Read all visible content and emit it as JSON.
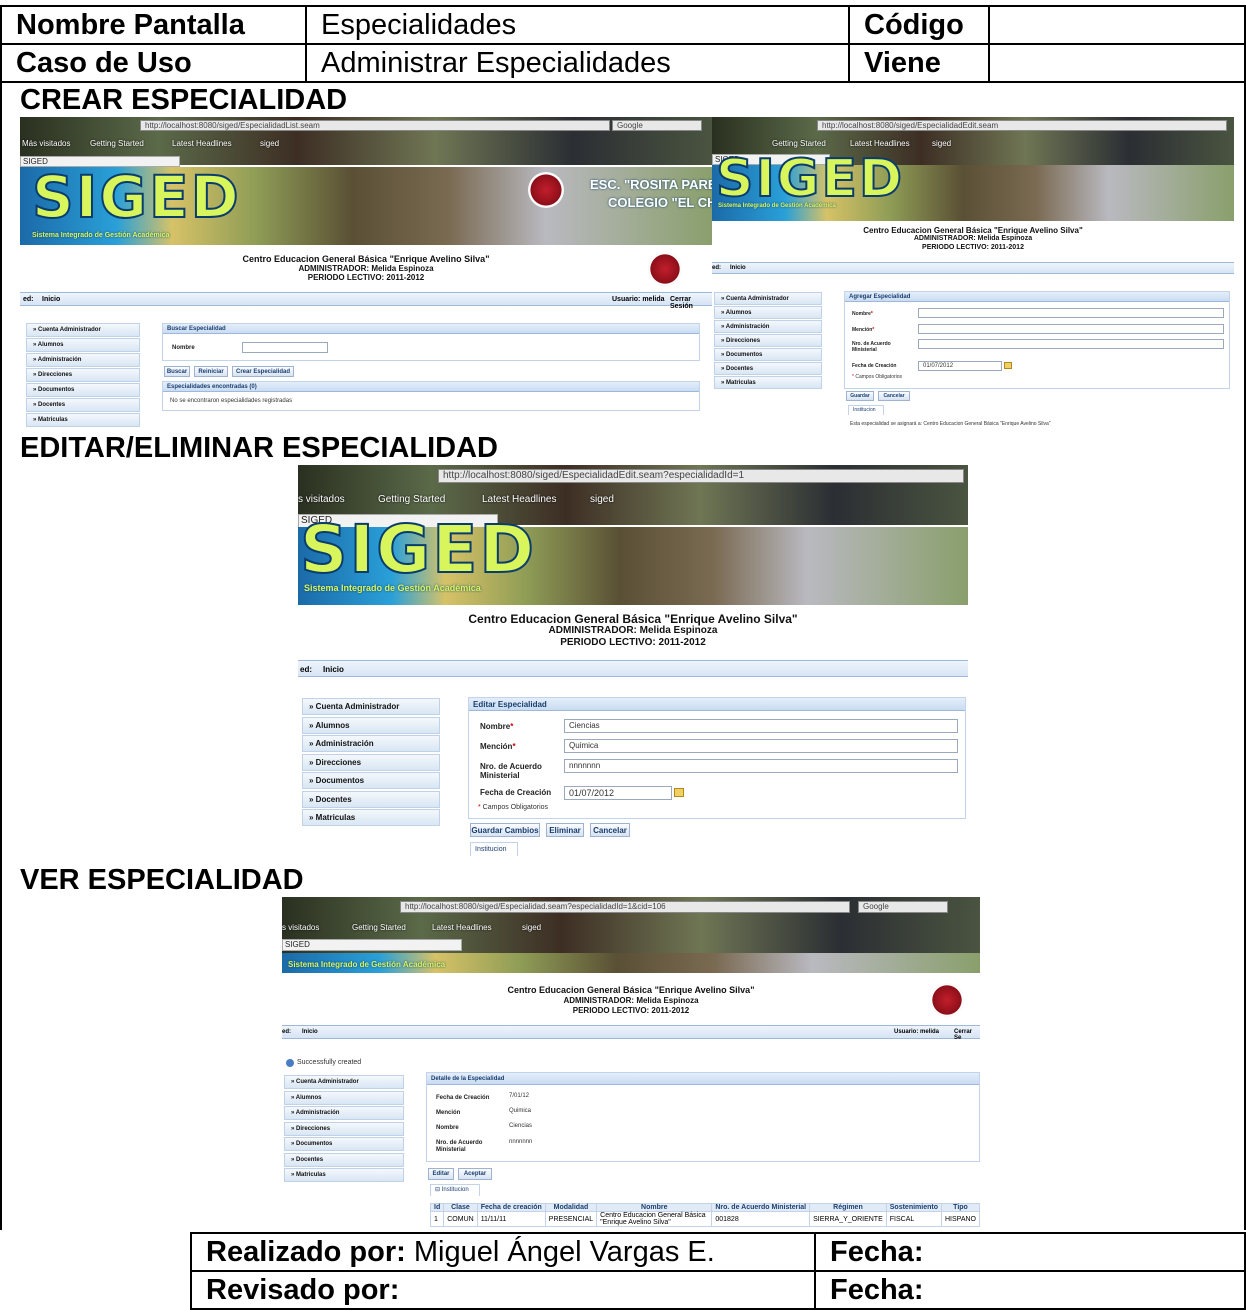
{
  "header": {
    "nombre_pantalla_label": "Nombre Pantalla",
    "nombre_pantalla_value": "Especialidades",
    "codigo_label": "Código",
    "caso_uso_label": "Caso de Uso",
    "caso_uso_value": "Administrar Especialidades",
    "viene_label": "Viene"
  },
  "sections": {
    "crear": "CREAR ESPECIALIDAD",
    "editar": "EDITAR/ELIMINAR ESPECIALIDAD",
    "ver": "VER ESPECIALIDAD"
  },
  "browser": {
    "url_list": "http://localhost:8080/siged/EspecialidadList.seam",
    "url_new": "http://localhost:8080/siged/EspecialidadEdit.seam",
    "url_edit": "http://localhost:8080/siged/EspecialidadEdit.seam?especialidadId=1",
    "url_view": "http://localhost:8080/siged/Especialidad.seam?especialidadId=1&cid=106",
    "search_engine": "Google",
    "bm_visitados": "Más visitados",
    "bm_visitados_cut": "s visitados",
    "bm_getting_started": "Getting Started",
    "bm_latest": "Latest Headlines",
    "bm_siged": "siged",
    "tab_title": "SIGED"
  },
  "app": {
    "logo": "SIGED",
    "slogan": "Sistema Integrado de Gestión Académica",
    "school_line1": "ESC. \"ROSITA PAREDES",
    "school_line2": "COLEGIO \"EL CHACO",
    "center_title": "Centro Educacion General Básica \"Enrique Avelino Silva\"",
    "admin": "ADMINISTRADOR: Melida Espinoza",
    "periodo": "PERIODO LECTIVO: 2011-2012",
    "breadcrumb_prefix": "ed:",
    "breadcrumb": "Inicio",
    "usuario": "Usuario: melida",
    "cerrar": "Cerrar Sesión",
    "cerrar_cut": "Cerrar Se",
    "menu": [
      "Cuenta Administrador",
      "Alumnos",
      "Administración",
      "Direcciones",
      "Documentos",
      "Docentes",
      "Matriculas"
    ]
  },
  "crear_list": {
    "panel_title": "Buscar Especialidad",
    "nombre_label": "Nombre",
    "btn_buscar": "Buscar",
    "btn_reiniciar": "Reiniciar",
    "btn_crear": "Crear Especialidad",
    "results_title": "Especialidades encontradas (0)",
    "no_results": "No se encontraron especialidades registradas"
  },
  "crear_form": {
    "panel_title": "Agregar Especialidad",
    "nombre_label": "Nombre",
    "mencion_label": "Mención",
    "acuerdo_label1": "Nro. de Acuerdo",
    "acuerdo_label2": "Ministerial",
    "fecha_label": "Fecha de Creación",
    "fecha_value": "01/07/2012",
    "obligatorios": "Campos Obligatorios",
    "btn_guardar": "Guardar",
    "btn_cancelar": "Cancelar",
    "tab": "Institucion",
    "asignara": "Esta especialidad se asignará a: Centro Educacion General Básica \"Enrique Avelino Silva\""
  },
  "editar": {
    "panel_title": "Editar Especialidad",
    "nombre_label": "Nombre",
    "nombre_value": "Ciencias",
    "mencion_label": "Mención",
    "mencion_value": "Quimica",
    "acuerdo_label1": "Nro. de Acuerdo",
    "acuerdo_label2": "Ministerial",
    "acuerdo_value": "nnnnnnn",
    "fecha_label": "Fecha de Creación",
    "fecha_value": "01/07/2012",
    "obligatorios": "Campos Obligatorios",
    "btn_guardar": "Guardar Cambios",
    "btn_eliminar": "Eliminar",
    "btn_cancelar": "Cancelar",
    "tab": "Institucion"
  },
  "ver": {
    "message": "Successfully created",
    "panel_title": "Detalle de la Especialidad",
    "fecha_label": "Fecha de Creación",
    "fecha_value": "7/01/12",
    "mencion_label": "Mención",
    "mencion_value": "Quimica",
    "nombre_label": "Nombre",
    "nombre_value": "Ciencias",
    "acuerdo_label1": "Nro. de Acuerdo",
    "acuerdo_label2": "Ministerial",
    "acuerdo_value": "nnnnnnn",
    "btn_editar": "Editar",
    "btn_aceptar": "Aceptar",
    "tab": "Institucion",
    "table_headers": [
      "Id",
      "Clase",
      "Fecha de creación",
      "Modalidad",
      "Nombre",
      "Nro. de Acuerdo Ministerial",
      "Régimen",
      "Sostenimiento",
      "Tipo"
    ],
    "table_row": [
      "1",
      "COMUN",
      "11/11/11",
      "PRESENCIAL",
      "Centro Educacion General Básica \"Enrique Avelino Silva\"",
      "001828",
      "SIERRA_Y_ORIENTE",
      "FISCAL",
      "HISPANO"
    ]
  },
  "footer": {
    "realizado_label": "Realizado por:",
    "realizado_value": "Miguel Ángel Vargas E.",
    "fecha_label": "Fecha:",
    "revisado_label": "Revisado por:",
    "fecha2_label": "Fecha:"
  }
}
